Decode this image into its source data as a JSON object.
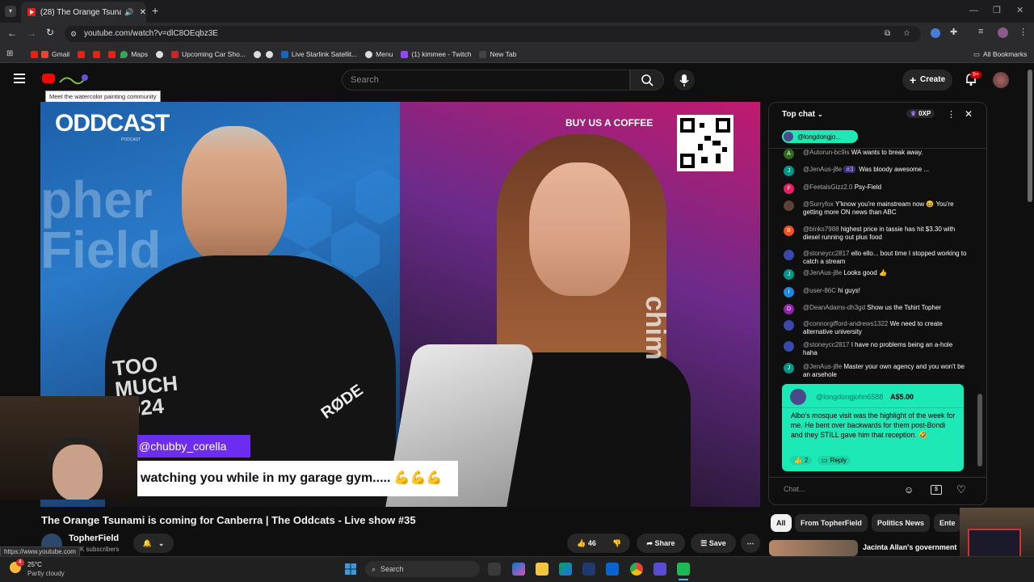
{
  "browser": {
    "tab_title": "(28) The Orange Tsunami is",
    "new_tab_symbol": "+",
    "url": "youtube.com/watch?v=dlC8OEqbz3E",
    "bookmarks": [
      "Gmail",
      "Maps",
      "Upcoming Car Sho...",
      "Live Starlink Satellit...",
      "Menu",
      "(1) kimmee - Twitch",
      "New Tab"
    ],
    "all_bookmarks": "All Bookmarks",
    "status_url": "https://www.youtube.com"
  },
  "youtube": {
    "search_placeholder": "Search",
    "create_label": "Create",
    "notif_badge": "9+",
    "logo_tooltip": "Meet the watercolor painting community"
  },
  "video": {
    "left_brand": "ODDCAST",
    "left_brand_sub": "PODCAST",
    "bg_text": "pher Field",
    "shirt_text": "TOO MUCH 2024",
    "mic_brand": "RØDE",
    "buy_coffee": "BUY US A COFFEE",
    "right_side_text": "chim",
    "overlay_user": "@chubby_corella",
    "overlay_message": "watching you while in my garage gym..... 💪💪💪"
  },
  "chat": {
    "mode": "Top chat",
    "xp": "0XP",
    "pinned_user": "@longdongjo...",
    "messages": [
      {
        "initial": "A",
        "color": "#33691e",
        "author": "@Autorun-bc9is",
        "badge": "",
        "text": "WA wants to break away."
      },
      {
        "initial": "J",
        "color": "#009688",
        "author": "@JenAus-j8e",
        "badge": "#3",
        "text": "Was bloody awesome ..."
      },
      {
        "initial": "F",
        "color": "#e91e63",
        "author": "@FeetalsGizz2.0",
        "badge": "",
        "text": "Psy-Field"
      },
      {
        "initial": "",
        "color": "#5d4037",
        "author": "@Surryfox",
        "badge": "",
        "text": "Y'know you're mainstream now 😆 You're getting more ON news than ABC"
      },
      {
        "initial": "B",
        "color": "#f4511e",
        "author": "@binks7988",
        "badge": "",
        "text": "highest price in tassie has hit $3.30 with diesel running out plus food"
      },
      {
        "initial": "",
        "color": "#3949ab",
        "author": "@stoneycc2817",
        "badge": "",
        "text": "ello ello... bout time I stopped working to catch a stream"
      },
      {
        "initial": "J",
        "color": "#009688",
        "author": "@JenAus-j8e",
        "badge": "",
        "text": "Looks good 👍"
      },
      {
        "initial": "I",
        "color": "#1e88e5",
        "author": "@user-86C",
        "badge": "",
        "text": "hi guys!"
      },
      {
        "initial": "D",
        "color": "#8e24aa",
        "author": "@DeanAdams-dh3gd",
        "badge": "",
        "text": "Show us the Tshirt Topher"
      },
      {
        "initial": "",
        "color": "#3949ab",
        "author": "@connorgifford-andrews1322",
        "badge": "",
        "text": "We need to create alternative university"
      },
      {
        "initial": "",
        "color": "#3949ab",
        "author": "@stoneycc2817",
        "badge": "",
        "text": "I have no problems being an a-hole haha"
      },
      {
        "initial": "J",
        "color": "#009688",
        "author": "@JenAus-j8e",
        "badge": "",
        "text": "Master your own agency and you won't be an arsehole"
      }
    ],
    "superchat": {
      "author": "@longdongjohn6588",
      "amount": "A$5.00",
      "text": "Albo's mosque visit was the highlight of the week for me. He bent over backwards for them post-Bondi and they STILL gave him that reception. 🤣",
      "likes": "2",
      "reply": "Reply"
    },
    "input_placeholder": "Chat..."
  },
  "below": {
    "title": "The Orange Tsunami is coming for Canberra | The Oddcats - Live show #35",
    "channel": "TopherField",
    "subscribers": "K subscribers",
    "likes": "46",
    "share": "Share",
    "save": "Save",
    "chips": [
      "All",
      "From TopherField",
      "Politics News",
      "Ente"
    ],
    "rec_title": "Jacinta Allan's government"
  },
  "taskbar": {
    "weather_temp": "25°C",
    "weather_desc": "Partly cloudy",
    "weather_badge": "4",
    "search": "Search"
  }
}
